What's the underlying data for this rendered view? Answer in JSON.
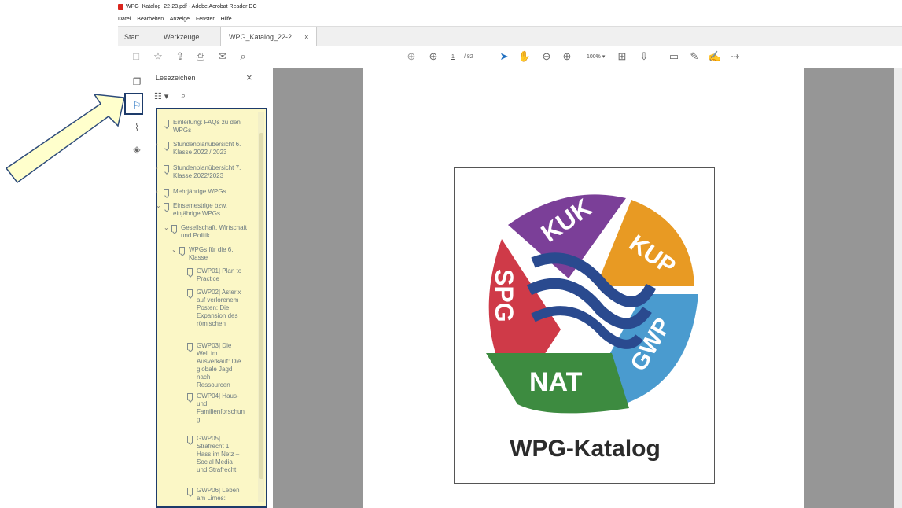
{
  "window": {
    "title": "WPG_Katalog_22-23.pdf - Adobe Acrobat Reader DC"
  },
  "menu": [
    "Datei",
    "Bearbeiten",
    "Anzeige",
    "Fenster",
    "Hilfe"
  ],
  "tabs": {
    "start": "Start",
    "tools": "Werkzeuge",
    "document": "WPG_Katalog_22-2...",
    "close": "×"
  },
  "toolbar": {
    "page_current": "1",
    "page_total": "/ 82",
    "zoom": "100%"
  },
  "bookmarks_panel": {
    "title": "Lesezeichen",
    "close": "×",
    "items": [
      {
        "label": "Einleitung: FAQs zu den WPGs",
        "level": 0
      },
      {
        "label": "Stundenplanübersicht 6. Klasse 2022 / 2023",
        "level": 0
      },
      {
        "label": "Stundenplanübersicht 7. Klasse 2022/2023",
        "level": 0
      },
      {
        "label": "Mehrjährige WPGs",
        "level": 0
      },
      {
        "label": "Einsemestrige bzw. einjährige WPGs",
        "level": 0
      },
      {
        "label": "Gesellschaft, Wirtschaft und Politik",
        "level": 1
      },
      {
        "label": "WPGs für die 6. Klasse",
        "level": 2
      },
      {
        "label": "GWP01| Plan to Practice",
        "level": 3
      },
      {
        "label": "GWP02| Asterix auf verlorenem Posten: Die Expansion des römischen",
        "level": 3
      },
      {
        "label": "GWP03| Die Welt im Ausverkauf: Die globale Jagd nach Ressourcen",
        "level": 3
      },
      {
        "label": "GWP04| Haus- und Familienforschun g",
        "level": 3
      },
      {
        "label": "GWP05| Strafrecht 1: Hass im Netz – Social Media und Strafrecht",
        "level": 3
      },
      {
        "label": "GWP06| Leben am Limes:",
        "level": 3
      }
    ]
  },
  "document": {
    "logo_segments": [
      "KUK",
      "KUP",
      "GWP",
      "NAT",
      "SPG"
    ],
    "title": "WPG-Katalog"
  },
  "colors": {
    "kuk": "#7b3f98",
    "kup": "#e89a23",
    "gwp": "#4a9bcf",
    "nat": "#3d8b40",
    "spg": "#cf3a48",
    "waves": "#2a4a8f",
    "highlight": "#fbf7c6",
    "frame": "#1d3b6a"
  }
}
